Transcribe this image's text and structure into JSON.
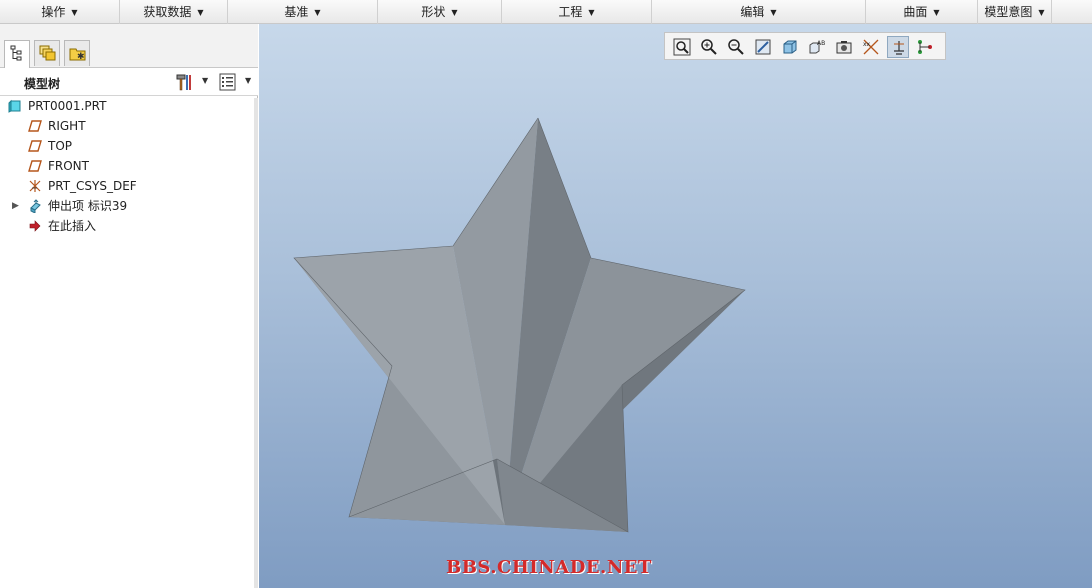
{
  "ribbon": {
    "groups": [
      {
        "label": "操作"
      },
      {
        "label": "获取数据"
      },
      {
        "label": "基准"
      },
      {
        "label": "形状"
      },
      {
        "label": "工程"
      },
      {
        "label": "编辑"
      },
      {
        "label": "曲面"
      },
      {
        "label": "模型意图"
      }
    ]
  },
  "panel": {
    "tabs": [
      {
        "icon": "model-tree-icon"
      },
      {
        "icon": "layers-icon"
      },
      {
        "icon": "favorites-folder-icon"
      }
    ],
    "tree_title": "模型树"
  },
  "tree": {
    "items": [
      {
        "label": "PRT0001.PRT",
        "icon": "part-icon"
      },
      {
        "label": "RIGHT",
        "icon": "datum-plane-icon"
      },
      {
        "label": "TOP",
        "icon": "datum-plane-icon"
      },
      {
        "label": "FRONT",
        "icon": "datum-plane-icon"
      },
      {
        "label": "PRT_CSYS_DEF",
        "icon": "coordinate-system-icon"
      },
      {
        "label": "伸出项 标识39",
        "icon": "protrusion-feature-icon"
      },
      {
        "label": "在此插入",
        "icon": "insert-here-arrow-icon"
      }
    ]
  },
  "viewport": {
    "toolbar": [
      {
        "icon": "refit-icon"
      },
      {
        "icon": "zoom-in-icon"
      },
      {
        "icon": "zoom-out-icon"
      },
      {
        "icon": "repaint-icon"
      },
      {
        "icon": "display-style-icon"
      },
      {
        "icon": "saved-views-icon"
      },
      {
        "icon": "view-manager-icon"
      },
      {
        "icon": "datum-display-icon"
      },
      {
        "icon": "spin-center-icon"
      },
      {
        "icon": "annotation-display-icon"
      }
    ],
    "watermark": "BBS.CHINADE.NET",
    "colors": {
      "background_top": "#c7d8ea",
      "background_bottom": "#7f9cc2",
      "model": "#8a9097"
    }
  }
}
